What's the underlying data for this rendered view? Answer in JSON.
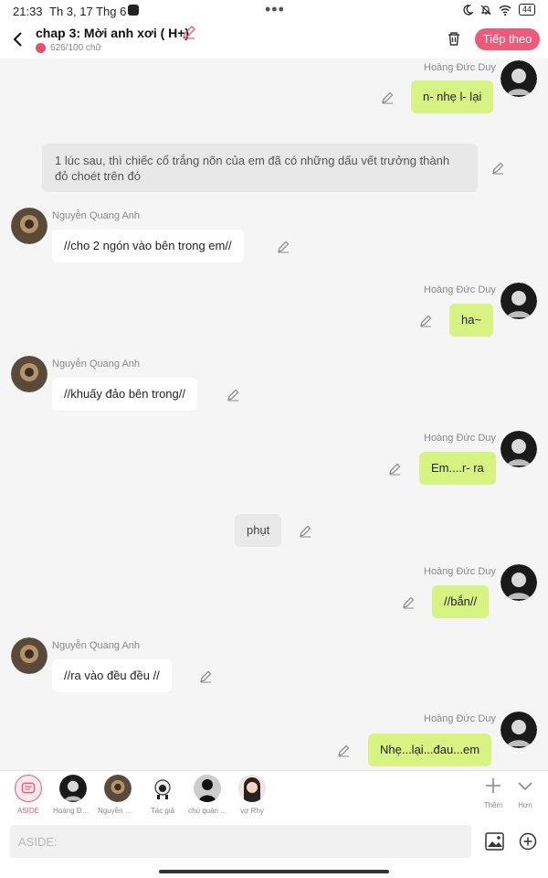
{
  "status": {
    "time": "21:33",
    "date": "Th 3, 17 Thg 6",
    "dots": "•••",
    "battery": "44"
  },
  "header": {
    "title": "chap 3: Mời anh xơi ( H+)",
    "word_count": "626/100 chữ",
    "next_label": "Tiếp theo"
  },
  "colors": {
    "accent": "#ef5a78",
    "my_bubble": "#d7f382"
  },
  "messages": [
    {
      "speaker": "Hoàng Đức Duy",
      "text": "n- nhẹ l- lại",
      "side": "right"
    },
    {
      "type": "narration",
      "text": "1 lúc sau, thì chiếc cổ trắng nõn của em đã có những dấu vết trưởng thành đỏ choét trên đó"
    },
    {
      "speaker": "Nguyễn Quang Anh",
      "text": "//cho 2 ngón vào bên trong em//",
      "side": "left"
    },
    {
      "speaker": "Hoàng Đức Duy",
      "text": "ha~",
      "side": "right"
    },
    {
      "speaker": "Nguyễn Quang Anh",
      "text": "//khuấy đảo bên trong//",
      "side": "left"
    },
    {
      "speaker": "Hoàng Đức Duy",
      "text": "Em....r- ra",
      "side": "right"
    },
    {
      "type": "aside",
      "text": "phụt"
    },
    {
      "speaker": "Hoàng Đức Duy",
      "text": "//bắn//",
      "side": "right"
    },
    {
      "speaker": "Nguyễn Quang Anh",
      "text": "//ra vào đều đều //",
      "side": "left"
    },
    {
      "speaker": "Hoàng Đức Duy",
      "text": "Nhẹ...lại...đau...em",
      "side": "right"
    }
  ],
  "characters": [
    {
      "label": "ASIDE",
      "icon": "aside-icon"
    },
    {
      "label": "Hoàng Đức Duy"
    },
    {
      "label": "Nguyễn Quang Anh"
    },
    {
      "label": "Tác giả"
    },
    {
      "label": "chú quán ..."
    },
    {
      "label": "vợ Rhy"
    }
  ],
  "tools": {
    "add": "Thêm",
    "more": "Hơn"
  },
  "input": {
    "placeholder": "ASIDE:"
  }
}
